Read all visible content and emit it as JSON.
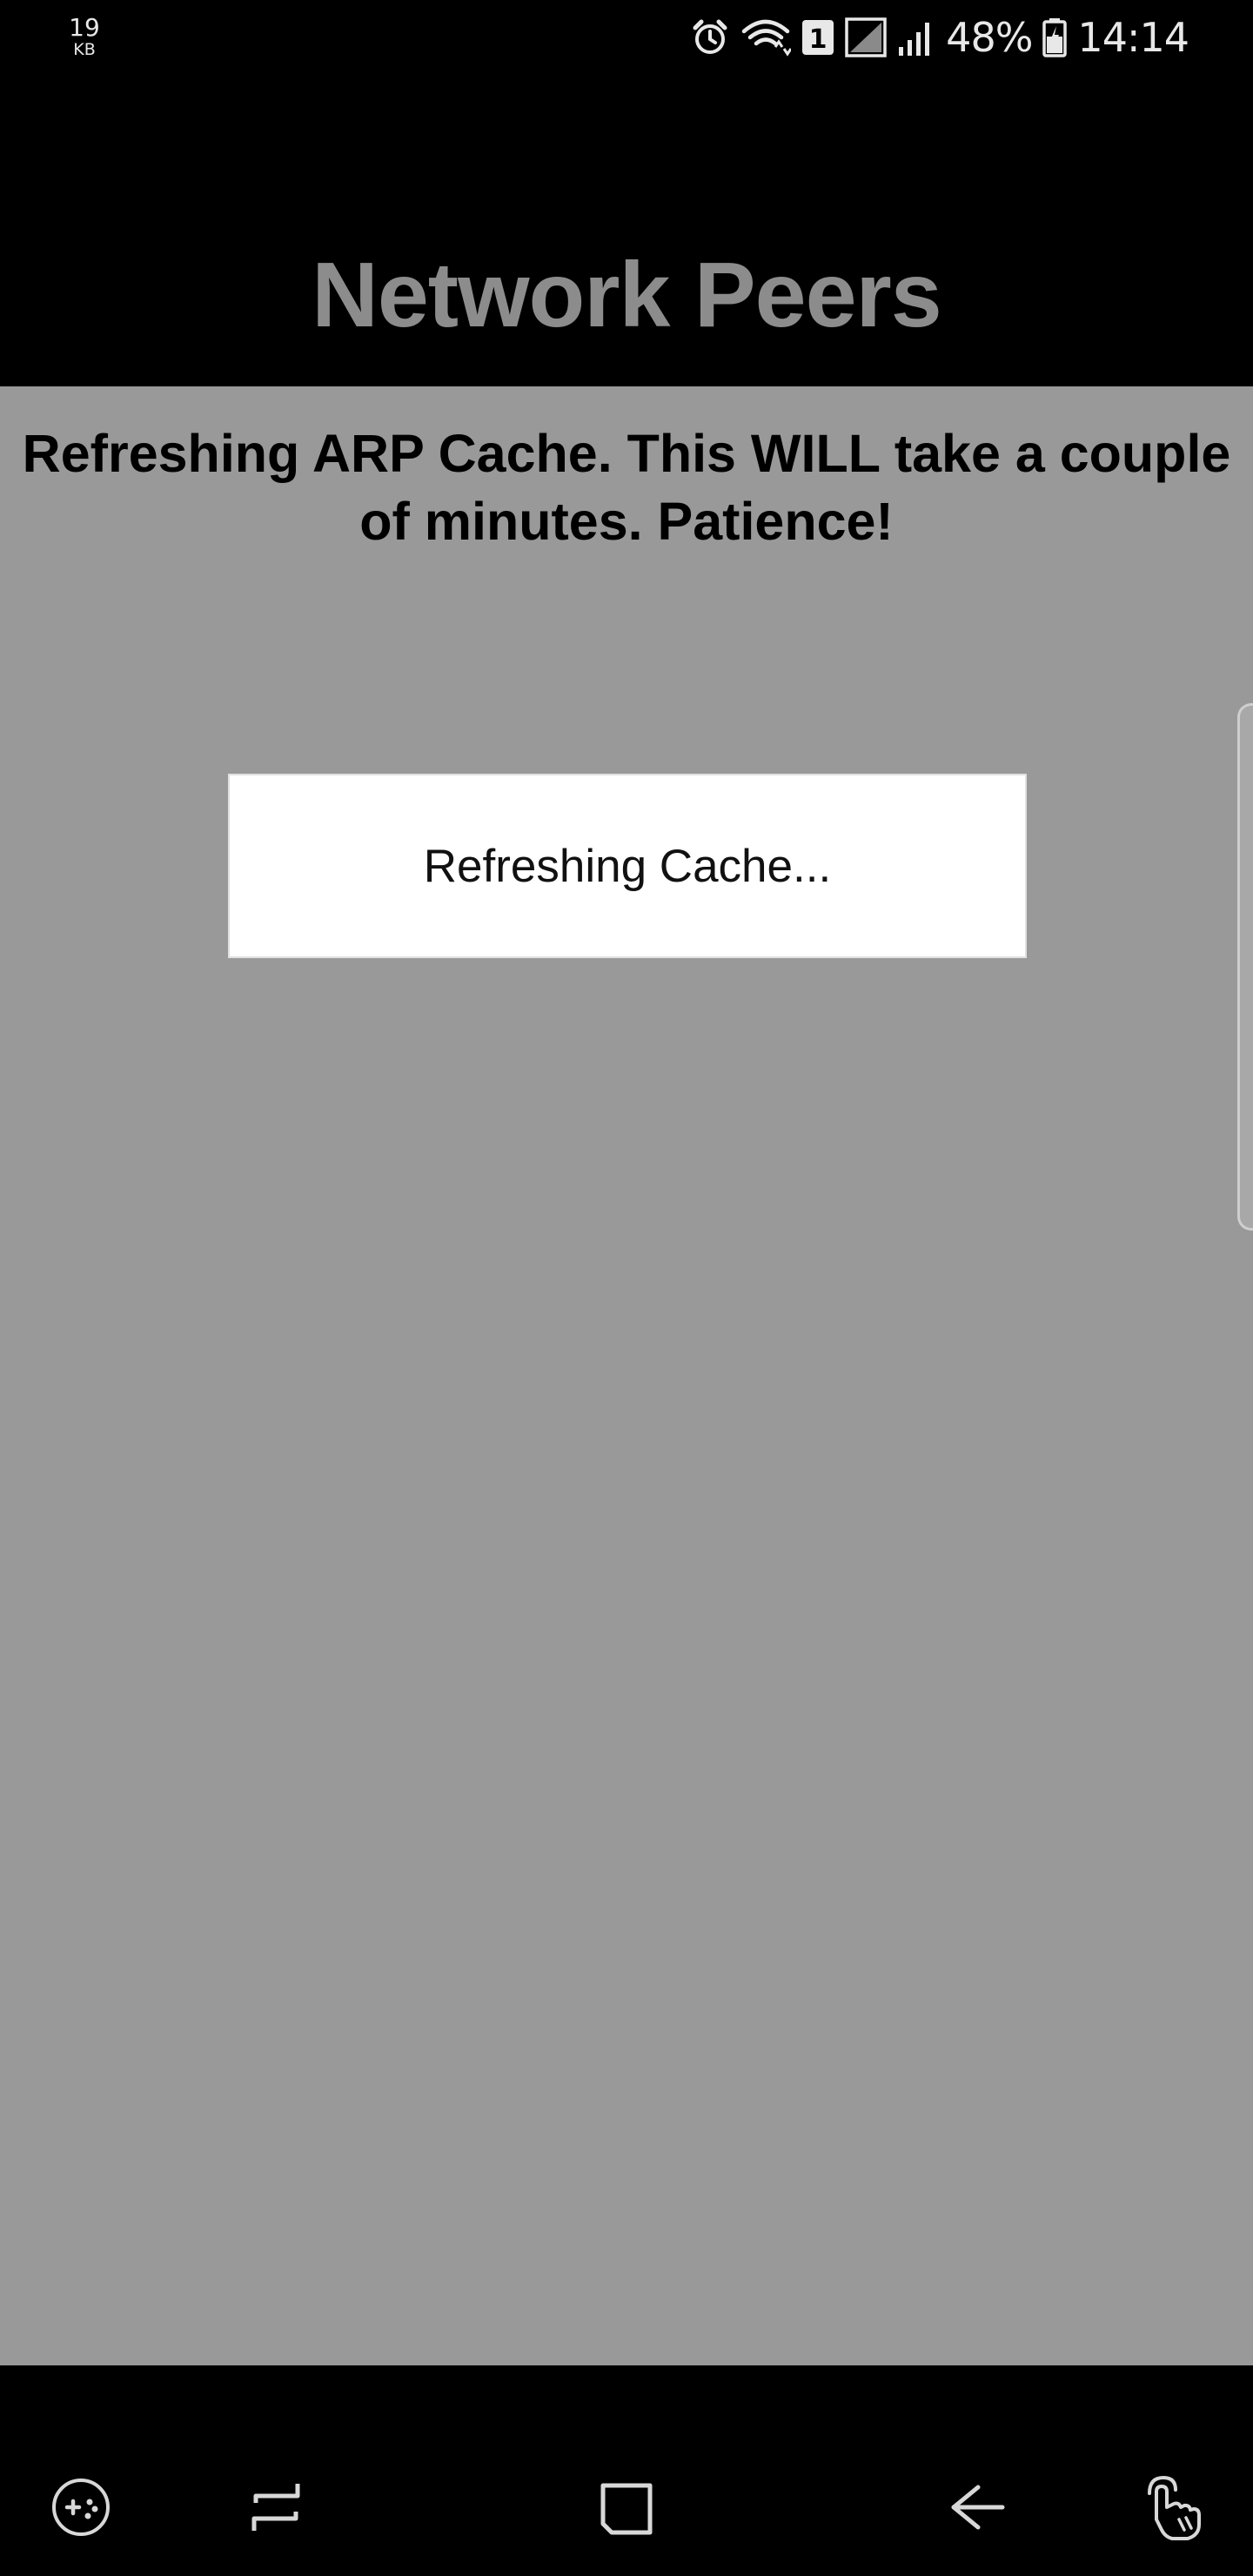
{
  "status_bar": {
    "net_speed_value": "19",
    "net_speed_unit": "KB",
    "icons": [
      "alarm-icon",
      "wifi-icon",
      "sim-1-icon",
      "no-signal-icon",
      "signal-icon",
      "battery-icon"
    ],
    "sim_label": "1",
    "battery_percent": "48%",
    "time": "14:14"
  },
  "header": {
    "title": "Network Peers",
    "background": "#000000",
    "title_color": "#8c8c8c"
  },
  "main": {
    "background": "#999999",
    "message": "Refreshing ARP Cache. This WILL take a couple of minutes. Patience!"
  },
  "dialog": {
    "text": "Refreshing Cache..."
  },
  "nav_bar": {
    "buttons": [
      "game-tools-icon",
      "recents-icon",
      "home-icon",
      "back-icon",
      "assistant-touch-icon"
    ]
  }
}
